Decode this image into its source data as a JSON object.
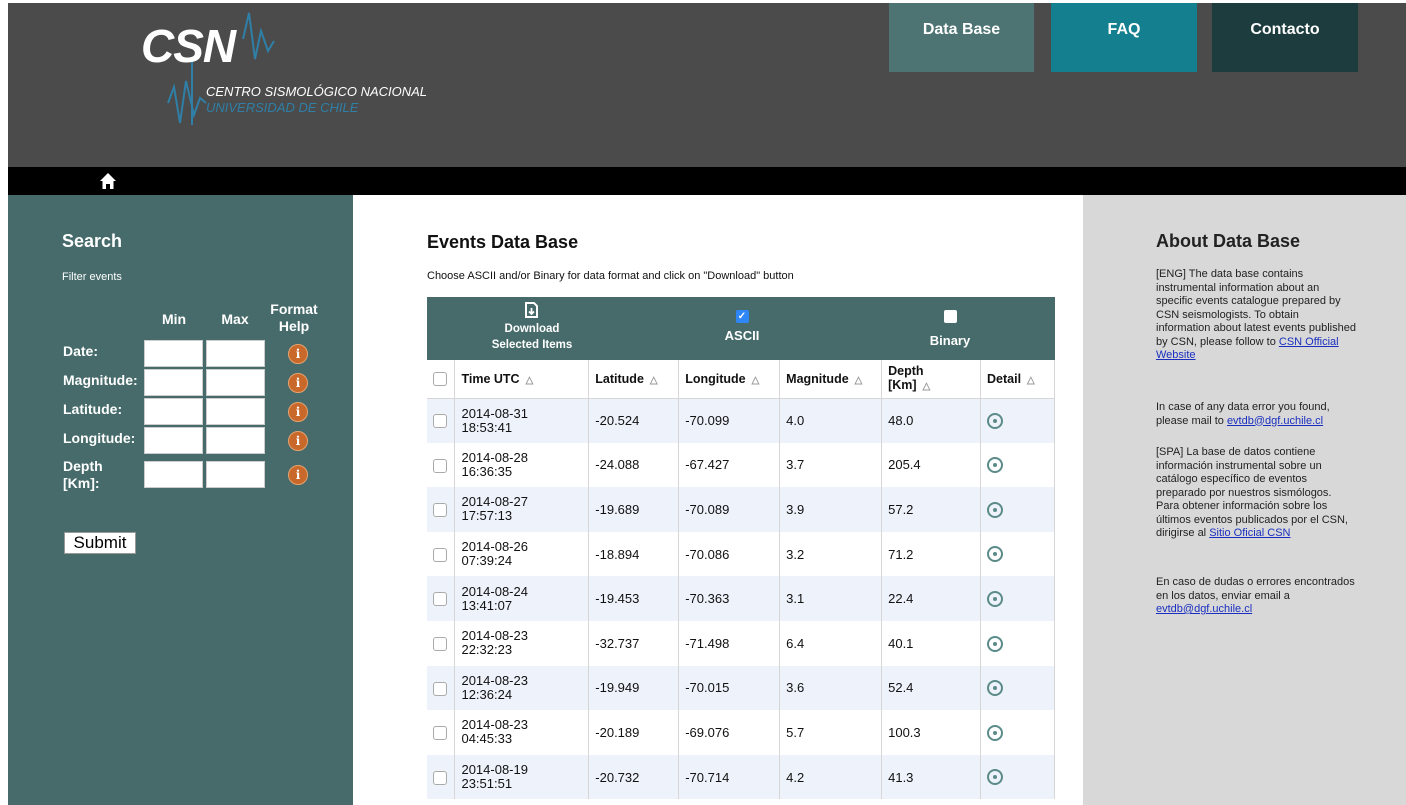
{
  "header": {
    "logo_text": "CSN",
    "org_line1": "CENTRO SISMOLÓGICO NACIONAL",
    "org_line2": "UNIVERSIDAD DE CHILE",
    "nav": [
      "Data Base",
      "FAQ",
      "Contacto"
    ]
  },
  "search": {
    "title": "Search",
    "subtitle": "Filter events",
    "col_min": "Min",
    "col_max": "Max",
    "col_format": "Format Help",
    "rows": [
      "Date:",
      "Magnitude:",
      "Latitude:",
      "Longitude:",
      "Depth [Km]:"
    ],
    "submit": "Submit"
  },
  "main": {
    "title": "Events Data Base",
    "subtitle": "Choose ASCII and/or Binary for data format and click on \"Download\" button",
    "download_line1": "Download",
    "download_line2": "Selected Items",
    "ascii": "ASCII",
    "ascii_checked": true,
    "binary": "Binary",
    "binary_checked": false,
    "columns": [
      "Time UTC",
      "Latitude",
      "Longitude",
      "Magnitude",
      "Depth [Km]",
      "Detail"
    ],
    "rows": [
      {
        "date": "2014-08-31",
        "time": "18:53:41",
        "lat": "-20.524",
        "lon": "-70.099",
        "mag": "4.0",
        "depth": "48.0"
      },
      {
        "date": "2014-08-28",
        "time": "16:36:35",
        "lat": "-24.088",
        "lon": "-67.427",
        "mag": "3.7",
        "depth": "205.4"
      },
      {
        "date": "2014-08-27",
        "time": "17:57:13",
        "lat": "-19.689",
        "lon": "-70.089",
        "mag": "3.9",
        "depth": "57.2"
      },
      {
        "date": "2014-08-26",
        "time": "07:39:24",
        "lat": "-18.894",
        "lon": "-70.086",
        "mag": "3.2",
        "depth": "71.2"
      },
      {
        "date": "2014-08-24",
        "time": "13:41:07",
        "lat": "-19.453",
        "lon": "-70.363",
        "mag": "3.1",
        "depth": "22.4"
      },
      {
        "date": "2014-08-23",
        "time": "22:32:23",
        "lat": "-32.737",
        "lon": "-71.498",
        "mag": "6.4",
        "depth": "40.1"
      },
      {
        "date": "2014-08-23",
        "time": "12:36:24",
        "lat": "-19.949",
        "lon": "-70.015",
        "mag": "3.6",
        "depth": "52.4"
      },
      {
        "date": "2014-08-23",
        "time": "04:45:33",
        "lat": "-20.189",
        "lon": "-69.076",
        "mag": "5.7",
        "depth": "100.3"
      },
      {
        "date": "2014-08-19",
        "time": "23:51:51",
        "lat": "-20.732",
        "lon": "-70.714",
        "mag": "4.2",
        "depth": "41.3"
      }
    ]
  },
  "about": {
    "title": "About Data Base",
    "eng_text": "[ENG] The data base contains instrumental information about an specific events catalogue prepared by CSN seismologists. To obtain information about latest events published by CSN, please follow to",
    "eng_link": "CSN Official Website",
    "eng_error_text": "In case of any data error you found, please mail to",
    "eng_email": "evtdb@dgf.uchile.cl",
    "spa_text": "[SPA] La base de datos contiene información instrumental sobre un catálogo específico de eventos preparado por nuestros sismólogos. Para obtener información sobre los últimos eventos publicados por el CSN, dirigirse al",
    "spa_link": "Sitio Oficial CSN",
    "spa_error_text": "En caso de dudas o errores encontrados en los datos, enviar email a",
    "spa_email": "evtdb@dgf.uchile.cl"
  },
  "colors": {
    "header_bg": "#4b4b4b",
    "sidebar_bg": "#476b6b",
    "nav_db": "#4d7373",
    "nav_faq": "#147f8f",
    "nav_contact": "#1d3c3d",
    "info_icon": "#c8682b",
    "about_bg": "#d8d8d8"
  }
}
